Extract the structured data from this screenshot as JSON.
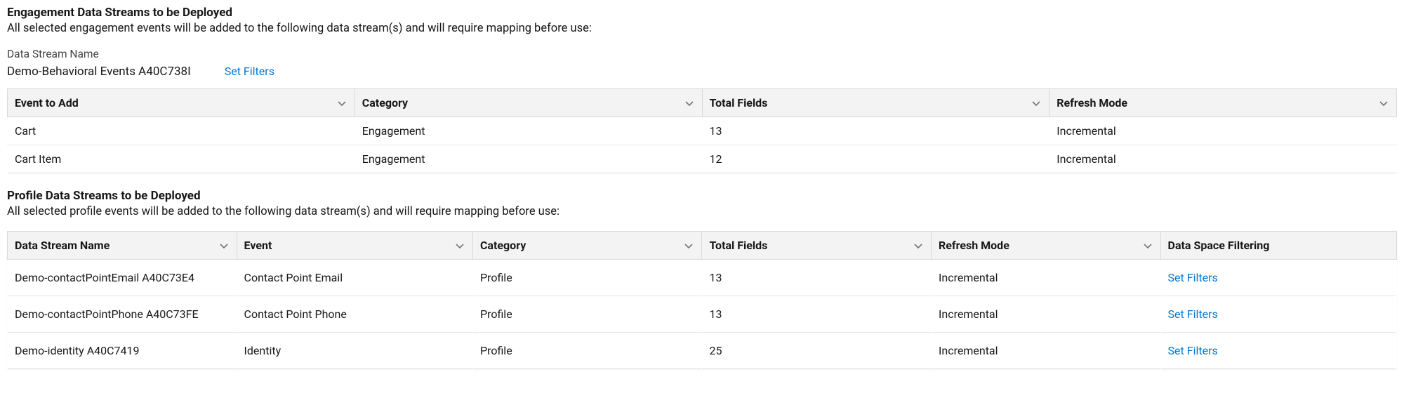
{
  "engagement": {
    "title": "Engagement Data Streams to be Deployed",
    "desc": "All selected engagement events will be added to the following data stream(s) and will require mapping before use:",
    "stream_label": "Data Stream Name",
    "stream_name": "Demo-Behavioral Events A40C738I",
    "set_filters": "Set Filters",
    "columns": {
      "event": "Event to Add",
      "category": "Category",
      "total_fields": "Total Fields",
      "refresh_mode": "Refresh Mode"
    },
    "rows": [
      {
        "event": "Cart",
        "category": "Engagement",
        "total_fields": "13",
        "refresh_mode": "Incremental"
      },
      {
        "event": "Cart Item",
        "category": "Engagement",
        "total_fields": "12",
        "refresh_mode": "Incremental"
      }
    ]
  },
  "profile": {
    "title": "Profile Data Streams to be Deployed",
    "desc": "All selected profile events will be added to the following data stream(s) and will require mapping before use:",
    "columns": {
      "stream": "Data Stream Name",
      "event": "Event",
      "category": "Category",
      "total_fields": "Total Fields",
      "refresh_mode": "Refresh Mode",
      "filtering": "Data Space Filtering"
    },
    "set_filters": "Set Filters",
    "rows": [
      {
        "stream": "Demo-contactPointEmail A40C73E4",
        "event": "Contact Point Email",
        "category": "Profile",
        "total_fields": "13",
        "refresh_mode": "Incremental"
      },
      {
        "stream": "Demo-contactPointPhone A40C73FE",
        "event": "Contact Point Phone",
        "category": "Profile",
        "total_fields": "13",
        "refresh_mode": "Incremental"
      },
      {
        "stream": "Demo-identity A40C7419",
        "event": "Identity",
        "category": "Profile",
        "total_fields": "25",
        "refresh_mode": "Incremental"
      }
    ]
  }
}
